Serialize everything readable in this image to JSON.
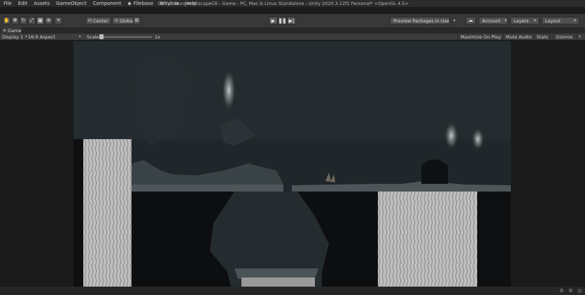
{
  "window": {
    "title": "Unity - DungeonEscapeC6 - Game - PC, Mac & Linux Standalone - Unity 2020.3.12f1 Personal* <OpenGL 4.5>"
  },
  "menu": {
    "items": [
      "File",
      "Edit",
      "Assets",
      "GameObject",
      "Component",
      "Filebase",
      "Window",
      "Help"
    ]
  },
  "toolbar": {
    "pivot_label": "Center",
    "space_label": "Global",
    "packages_label": "Preview Packages in Use",
    "account_label": "Account",
    "layers_label": "Layers",
    "layout_label": "Layout"
  },
  "game_tab": {
    "label": "Game"
  },
  "game_bar": {
    "display_label": "Display 1",
    "aspect_label": "16:9 Aspect",
    "scale_label": "Scale",
    "scale_value": "1x",
    "scale_level": 0.0,
    "maximize_label": "Maximize On Play",
    "mute_label": "Mute Audio",
    "stats_label": "Stats",
    "gizmos_label": "Gizmos"
  },
  "icons": {
    "filebase": "filebase-icon",
    "hand_tool": "hand-icon",
    "move_tool": "move-icon",
    "rotate_tool": "rotate-icon",
    "scale_tool": "scale-icon",
    "rect_tool": "rect-icon",
    "transform_tool": "transform-icon",
    "custom_tool": "tools-icon",
    "play": "play-icon",
    "pause": "pause-icon",
    "step": "step-icon",
    "cloud": "cloud-icon",
    "game_tab": "game-controller-icon"
  },
  "colors": {
    "editor_bg": "#383838",
    "scene_bg": "#1f2527",
    "waterfall": "#c9c9c9"
  }
}
